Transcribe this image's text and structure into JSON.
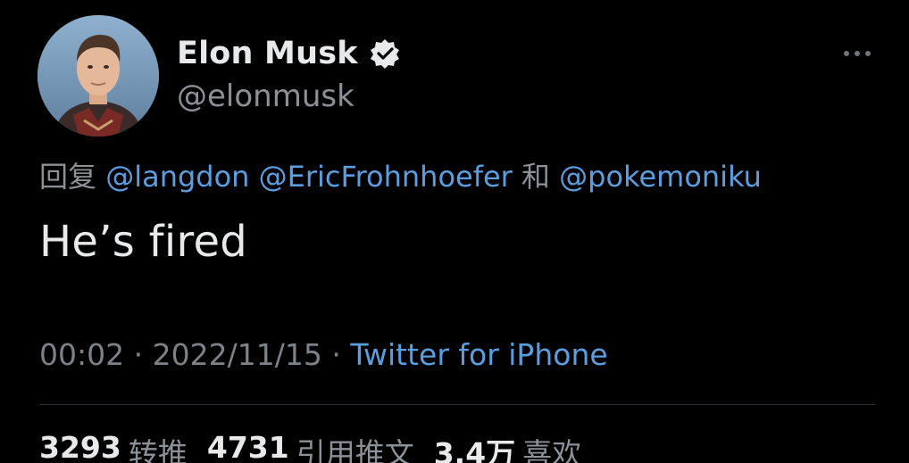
{
  "author": {
    "display_name": "Elon Musk",
    "handle": "@elonmusk",
    "avatar_icon": "profile-avatar",
    "verified_icon": "verified-badge-icon"
  },
  "reply": {
    "prefix": "回复",
    "mentions": [
      "@langdon",
      "@EricFrohnhoefer",
      "@pokemoniku"
    ],
    "joiner": "和"
  },
  "tweet": {
    "text": "He’s fired"
  },
  "meta": {
    "time": "00:02",
    "dot": "·",
    "date": "2022/11/15",
    "source": "Twitter for iPhone"
  },
  "stats": {
    "retweets_count": "3293",
    "retweets_label": "转推",
    "quotes_count": "4731",
    "quotes_label": "引用推文",
    "likes_count": "3.4万",
    "likes_label": "喜欢"
  },
  "colors": {
    "background": "#000000",
    "primary_text": "#e7e9ea",
    "secondary_text": "#8b9196",
    "link": "#5b9ee0"
  }
}
